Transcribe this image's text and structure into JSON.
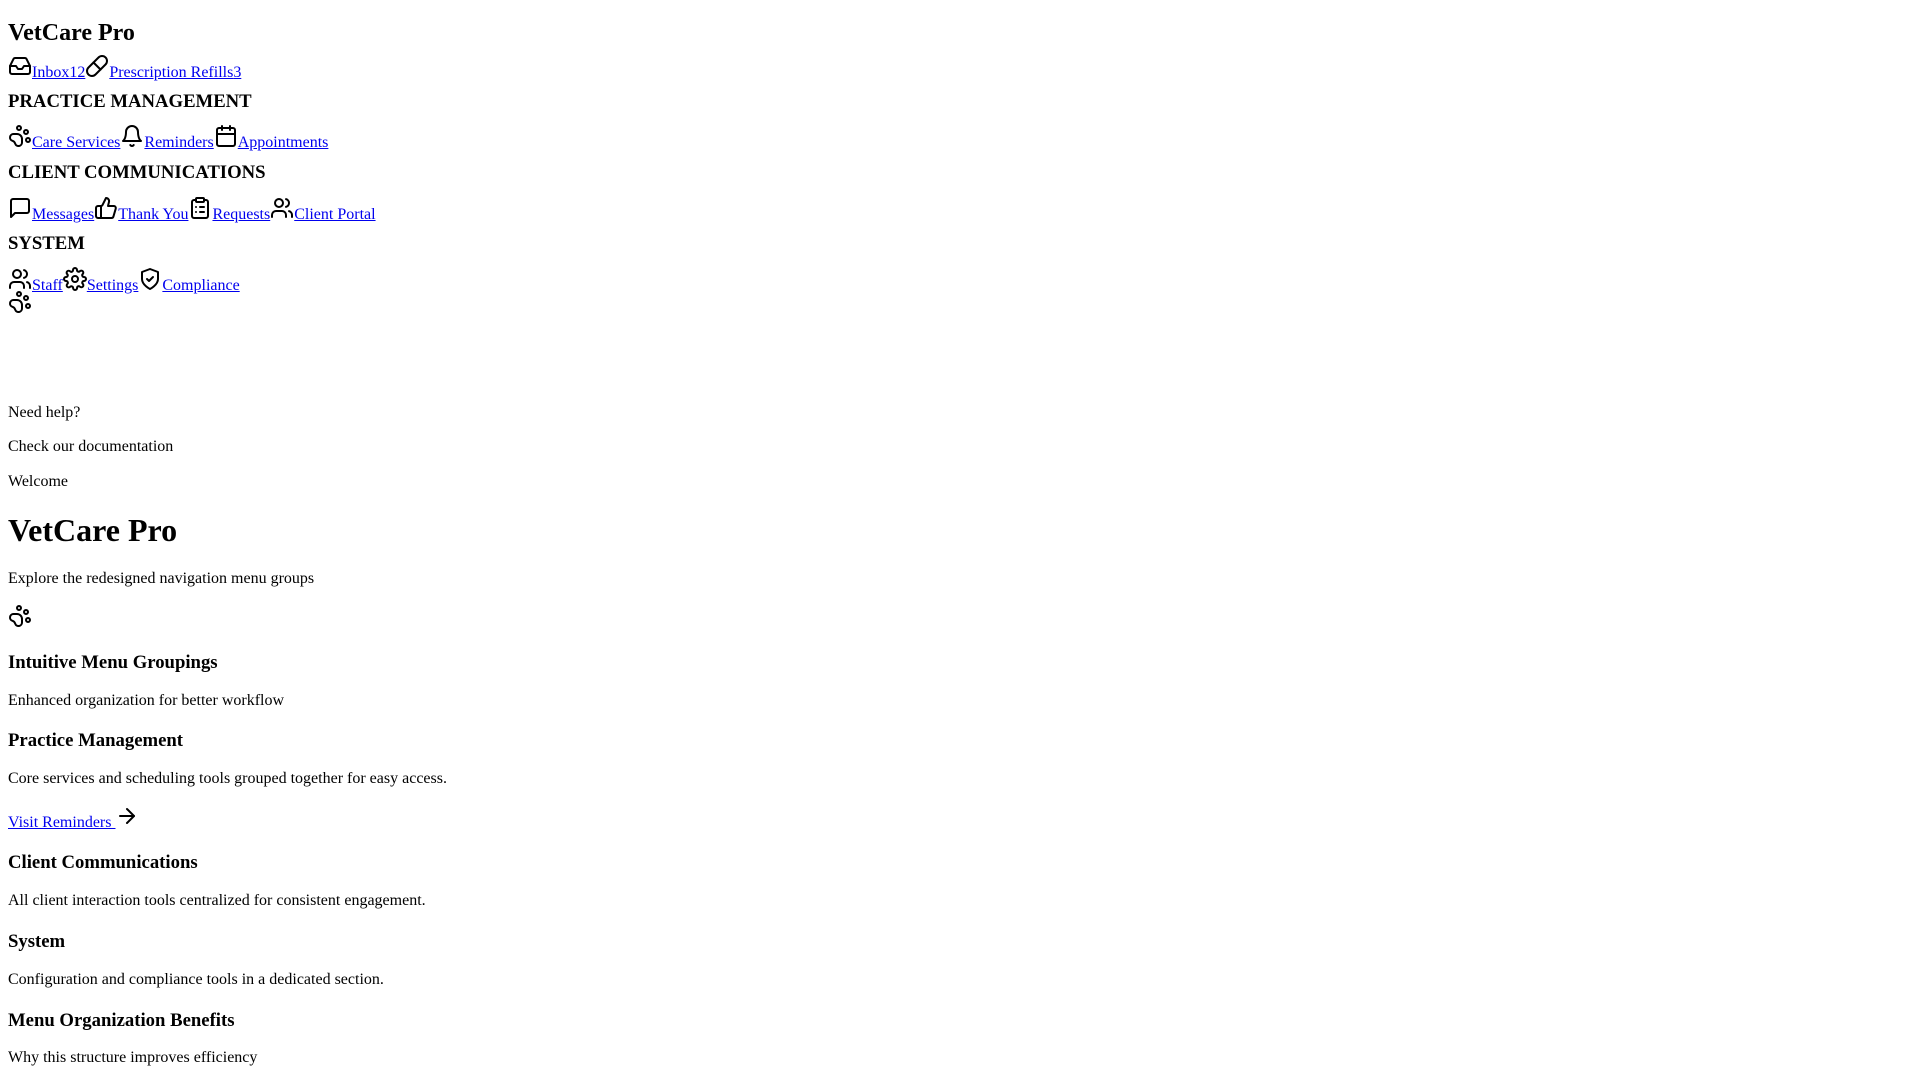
{
  "app": {
    "title": "VetCare Pro"
  },
  "top_nav": [
    {
      "label": "Inbox",
      "badge": "12",
      "icon": "inbox-icon"
    },
    {
      "label": "Prescription Refills",
      "badge": "3",
      "icon": "pill-icon"
    }
  ],
  "groups": {
    "practice": {
      "title": "PRACTICE MANAGEMENT",
      "items": [
        {
          "label": "Care Services",
          "icon": "paw-icon"
        },
        {
          "label": "Reminders",
          "icon": "bell-icon"
        },
        {
          "label": "Appointments",
          "icon": "calendar-icon"
        }
      ]
    },
    "client": {
      "title": "CLIENT COMMUNICATIONS",
      "items": [
        {
          "label": "Messages",
          "icon": "message-icon"
        },
        {
          "label": "Thank You",
          "icon": "thumbs-up-icon"
        },
        {
          "label": "Requests",
          "icon": "clipboard-icon"
        },
        {
          "label": "Client Portal",
          "icon": "users-icon"
        }
      ]
    },
    "system": {
      "title": "SYSTEM",
      "items": [
        {
          "label": "Staff",
          "icon": "users-icon"
        },
        {
          "label": "Settings",
          "icon": "gear-icon"
        },
        {
          "label": "Compliance",
          "icon": "shield-check-icon"
        }
      ]
    }
  },
  "help": {
    "title": "Need help?",
    "subtitle": "Check our documentation"
  },
  "main": {
    "welcome": "Welcome",
    "title": "VetCare Pro",
    "subtitle": "Explore the redesigned navigation menu groups",
    "section_title": "Intuitive Menu Groupings",
    "section_subtitle": "Enhanced organization for better workflow",
    "cards": [
      {
        "title": "Practice Management",
        "description": "Core services and scheduling tools grouped together for easy access.",
        "link": "Visit Reminders"
      },
      {
        "title": "Client Communications",
        "description": "All client interaction tools centralized for consistent engagement."
      },
      {
        "title": "System",
        "description": "Configuration and compliance tools in a dedicated section."
      }
    ],
    "benefits_title": "Menu Organization Benefits",
    "benefits_subtitle": "Why this structure improves efficiency"
  }
}
